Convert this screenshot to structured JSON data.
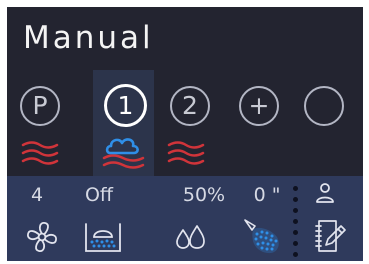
{
  "header": {
    "title": "Manual"
  },
  "modes": [
    {
      "label": "P",
      "selected": false,
      "symbol": "heat-waves-icon"
    },
    {
      "label": "1",
      "selected": true,
      "symbol": "cloud-over-heat-icon"
    },
    {
      "label": "2",
      "selected": false,
      "symbol": "heat-waves-icon"
    },
    {
      "label": "+",
      "selected": false,
      "symbol": ""
    },
    {
      "label": "",
      "selected": false,
      "symbol": ""
    }
  ],
  "metrics": {
    "fan": {
      "value": "4",
      "icon": "fan-icon"
    },
    "steam": {
      "value": "Off",
      "icon": "steam-tray-icon"
    },
    "humidity": {
      "value": "50%",
      "icon": "water-drops-icon"
    },
    "spray": {
      "value": "0 \"",
      "icon": "spray-nozzle-icon"
    },
    "user": {
      "icon": "user-icon"
    },
    "notes": {
      "icon": "notes-edit-icon"
    }
  },
  "colors": {
    "background": "#232430",
    "panel": "#2f3a5c",
    "selected_tab": "#2c344b",
    "heat_red": "#d0343a",
    "cloud_blue": "#2f8fe8",
    "icon_light": "#e2e4ee"
  }
}
